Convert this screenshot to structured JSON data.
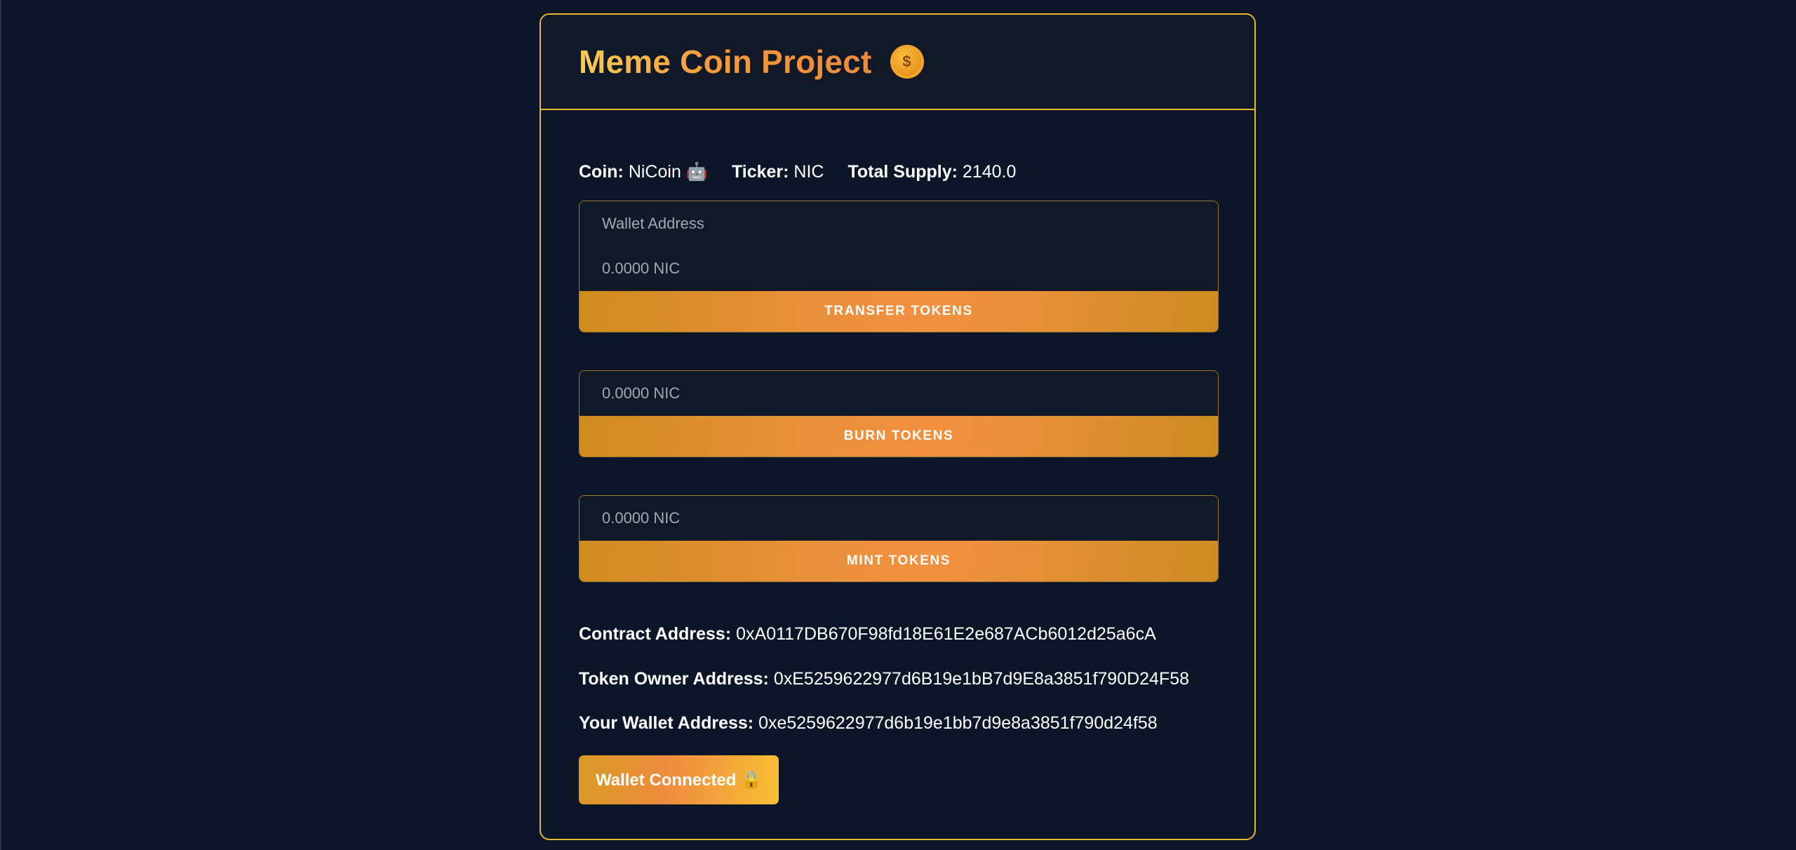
{
  "header": {
    "title": "Meme Coin Project",
    "coin_icon": "dollar-coin-icon",
    "coin_icon_glyph": "$"
  },
  "info": {
    "coin_label": "Coin:",
    "coin_value": "NiCoin 🤖",
    "ticker_label": "Ticker:",
    "ticker_value": "NIC",
    "supply_label": "Total Supply:",
    "supply_value": "2140.0"
  },
  "transfer": {
    "address_placeholder": "Wallet Address",
    "amount_placeholder": "0.0000 NIC",
    "button_label": "TRANSFER TOKENS"
  },
  "burn": {
    "amount_placeholder": "0.0000 NIC",
    "button_label": "BURN TOKENS"
  },
  "mint": {
    "amount_placeholder": "0.0000 NIC",
    "button_label": "MINT TOKENS"
  },
  "addresses": {
    "contract_label": "Contract Address:",
    "contract_value": "0xA0117DB670F98fd18E61E2e687ACb6012d25a6cA",
    "owner_label": "Token Owner Address:",
    "owner_value": "0xE5259622977d6B19e1bB7d9E8a3851f790D24F58",
    "wallet_label": "Your Wallet Address:",
    "wallet_value": "0xe5259622977d6b19e1bb7d9e8a3851f790d24f58"
  },
  "wallet_button": {
    "label": "Wallet Connected 🔒"
  },
  "colors": {
    "background": "#0d1628",
    "accent_border": "#e9b632",
    "button_orange": "#f29040"
  }
}
